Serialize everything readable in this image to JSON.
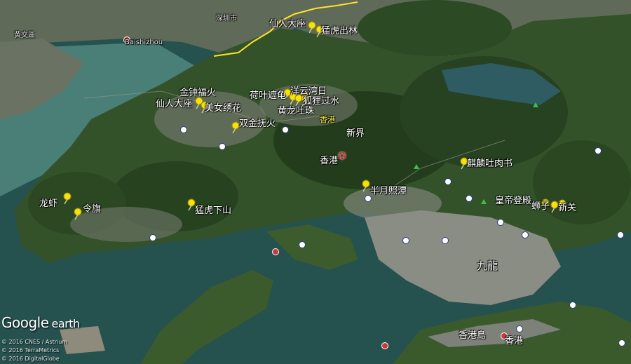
{
  "app": {
    "logo_main": "Google",
    "logo_sub": "earth"
  },
  "copyright": [
    "© 2016 CNES / Astrium",
    "© 2016 TerraMetrics",
    "© 2016 DigitalGlobe"
  ],
  "places": [
    {
      "id": "xianren1",
      "text": "仙人大座"
    },
    {
      "id": "menghu1",
      "text": "猛虎出林"
    },
    {
      "id": "jinzhong",
      "text": "金钟福火"
    },
    {
      "id": "xianren2",
      "text": "仙人大座"
    },
    {
      "id": "meinv",
      "text": "美女绣花"
    },
    {
      "id": "heye",
      "text": "荷叶遮龟"
    },
    {
      "id": "yanyun",
      "text": "洋云湾日"
    },
    {
      "id": "huli",
      "text": "狐狸过水"
    },
    {
      "id": "huanglong",
      "text": "黄龙吐珠"
    },
    {
      "id": "shuangjin",
      "text": "双金抚火"
    },
    {
      "id": "xiangang_y",
      "text": "香港"
    },
    {
      "id": "xinjie",
      "text": "新界"
    },
    {
      "id": "xianggang_c",
      "text": "香港"
    },
    {
      "id": "qilin",
      "text": "麒麟吐肉书"
    },
    {
      "id": "banyue",
      "text": "半月照潭"
    },
    {
      "id": "huangdi",
      "text": "皇帝登殿"
    },
    {
      "id": "shizi",
      "text": "蛳子"
    },
    {
      "id": "xinguan",
      "text": "新关"
    },
    {
      "id": "longxia",
      "text": "龙虾"
    },
    {
      "id": "lingqi",
      "text": "令旗"
    },
    {
      "id": "menghu2",
      "text": "猛虎下山"
    },
    {
      "id": "jiulong",
      "text": "九龍"
    },
    {
      "id": "xianggangdao",
      "text": "香港島"
    },
    {
      "id": "xianggang_isl",
      "text": "香港"
    },
    {
      "id": "shenzhen",
      "text": "深圳市"
    },
    {
      "id": "baishizhou",
      "text": "Baishizhou"
    },
    {
      "id": "huangtian",
      "text": "黄交區"
    }
  ],
  "pins_count": 22
}
